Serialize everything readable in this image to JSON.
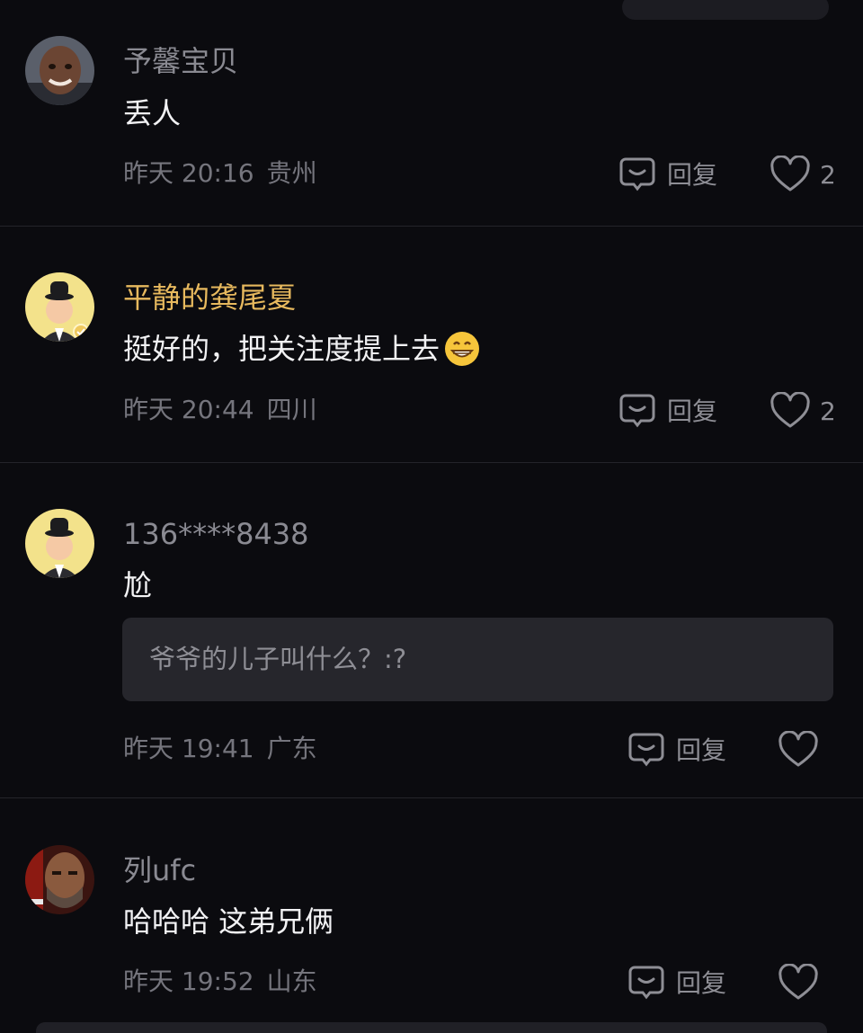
{
  "comments": [
    {
      "username": "予馨宝贝",
      "text": "丢人",
      "time": "昨天 20:16",
      "location": "贵州",
      "reply_label": "回复",
      "likes": "2"
    },
    {
      "username": "平静的龚尾夏",
      "text": "挺好的，把关注度提上去",
      "time": "昨天 20:44",
      "location": "四川",
      "reply_label": "回复",
      "likes": "2"
    },
    {
      "username": "136****8438",
      "text": "尬",
      "quote": "爷爷的儿子叫什么？:?",
      "time": "昨天 19:41",
      "location": "广东",
      "reply_label": "回复"
    },
    {
      "username": "列ufc",
      "text": "哈哈哈 这弟兄俩",
      "time": "昨天 19:52",
      "location": "山东",
      "reply_label": "回复"
    }
  ],
  "colors": {
    "background": "#0b0b0f",
    "vip_name": "#e7b95e",
    "name": "#8a8a92",
    "text": "#f2f2f4",
    "meta": "#75757d"
  }
}
